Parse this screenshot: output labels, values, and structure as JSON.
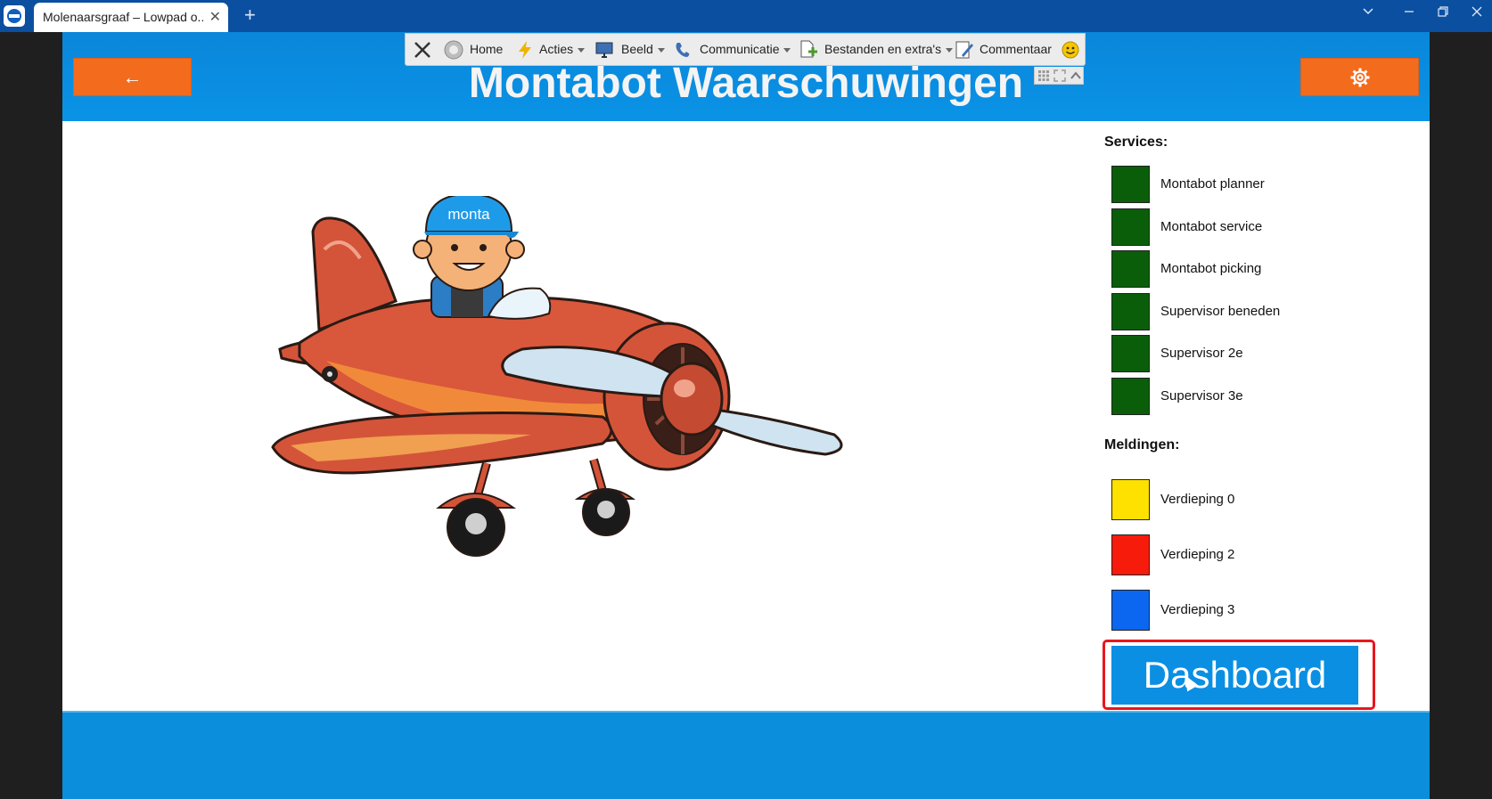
{
  "browser": {
    "tab_title": "Molenaarsgraaf – Lowpad o...",
    "tab_close": "✕",
    "new_tab": "+"
  },
  "toolbar": {
    "home": "Home",
    "acties": "Acties",
    "beeld": "Beeld",
    "communicatie": "Communicatie",
    "bestanden": "Bestanden en extra's",
    "commentaar": "Commentaar"
  },
  "header": {
    "title": "Montabot Waarschuwingen",
    "back_label": "←",
    "settings_icon": "gear-icon"
  },
  "plane": {
    "cap_text": "monta"
  },
  "services": {
    "heading": "Services:",
    "items": [
      {
        "label": "Montabot planner",
        "color": "#0a5e0a"
      },
      {
        "label": "Montabot service",
        "color": "#0a5e0a"
      },
      {
        "label": "Montabot picking",
        "color": "#0a5e0a"
      },
      {
        "label": "Supervisor beneden",
        "color": "#0a5e0a"
      },
      {
        "label": "Supervisor 2e",
        "color": "#0a5e0a"
      },
      {
        "label": "Supervisor 3e",
        "color": "#0a5e0a"
      }
    ]
  },
  "meldingen": {
    "heading": "Meldingen:",
    "items": [
      {
        "label": "Verdieping 0",
        "color": "#ffe100"
      },
      {
        "label": "Verdieping 2",
        "color": "#f71b0c"
      },
      {
        "label": "Verdieping 3",
        "color": "#0b67f0"
      }
    ]
  },
  "dashboard": {
    "label": "Dashboard"
  },
  "colors": {
    "header_blue": "#0a8fe3",
    "accent_orange": "#f36b1c",
    "highlight_red": "#e8161c"
  }
}
